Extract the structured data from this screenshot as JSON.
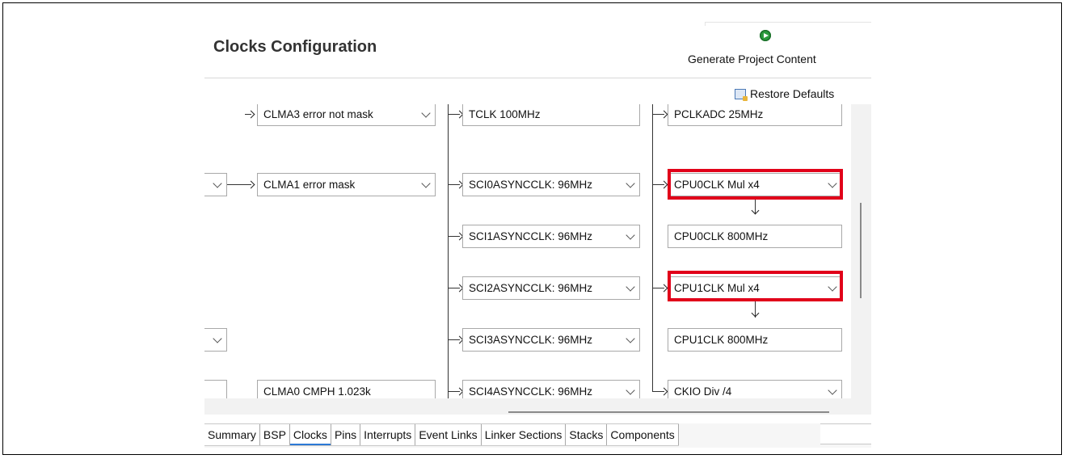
{
  "header": {
    "title": "Clocks Configuration",
    "generate_label": "Generate Project Content",
    "restore_label": "Restore Defaults"
  },
  "diagram": {
    "left_col": {
      "clma3": "CLMA3 error not mask",
      "clma1": "CLMA1 error mask",
      "clma0": "CLMA0 CMPH 1.023k"
    },
    "mid_col": {
      "tclk": "TCLK 100MHz",
      "sci0": "SCI0ASYNCCLK: 96MHz",
      "sci1": "SCI1ASYNCCLK: 96MHz",
      "sci2": "SCI2ASYNCCLK: 96MHz",
      "sci3": "SCI3ASYNCCLK: 96MHz",
      "sci4": "SCI4ASYNCCLK: 96MHz"
    },
    "right_col": {
      "pclkadc": "PCLKADC 25MHz",
      "cpu0_mul": "CPU0CLK Mul x4",
      "cpu0_out": "CPU0CLK 800MHz",
      "cpu1_mul": "CPU1CLK Mul x4",
      "cpu1_out": "CPU1CLK 800MHz",
      "ckio": "CKIO Div /4"
    }
  },
  "tabs": [
    "Summary",
    "BSP",
    "Clocks",
    "Pins",
    "Interrupts",
    "Event Links",
    "Linker Sections",
    "Stacks",
    "Components"
  ],
  "active_tab": "Clocks",
  "colors": {
    "highlight": "#e1001a",
    "active_tab_underline": "#2c79d6",
    "generate_icon": "#2a9a3c"
  },
  "icons": {
    "generate": "play-circle-icon",
    "restore": "restore-defaults-icon",
    "dropdown": "chevron-down-icon"
  }
}
